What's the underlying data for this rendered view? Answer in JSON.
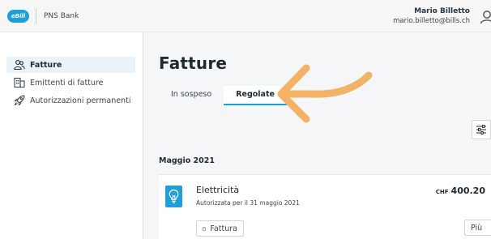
{
  "header": {
    "logo_text": "eBill",
    "bank_name": "PNS Bank",
    "user_name": "Mario Billetto",
    "user_email": "mario.billetto@bills.ch"
  },
  "sidebar": {
    "items": [
      {
        "label": "Fatture",
        "icon": "people-icon",
        "active": true
      },
      {
        "label": "Emittenti di fatture",
        "icon": "building-icon",
        "active": false
      },
      {
        "label": "Autorizzazioni permanenti",
        "icon": "rocket-icon",
        "active": false
      }
    ]
  },
  "main": {
    "title": "Fatture",
    "tabs": [
      {
        "label": "In sospeso",
        "active": false
      },
      {
        "label": "Regolate",
        "active": true
      }
    ],
    "section": "Maggio 2021",
    "bill": {
      "name": "Elettricità",
      "subtitle": "Autorizzata per il 31 maggio 2021",
      "currency": "CHF",
      "amount": "400.20",
      "doc_button": "Fattura",
      "more_button": "Più"
    }
  },
  "colors": {
    "accent": "#1d9fd9",
    "annotation_arrow": "#f2b366"
  }
}
